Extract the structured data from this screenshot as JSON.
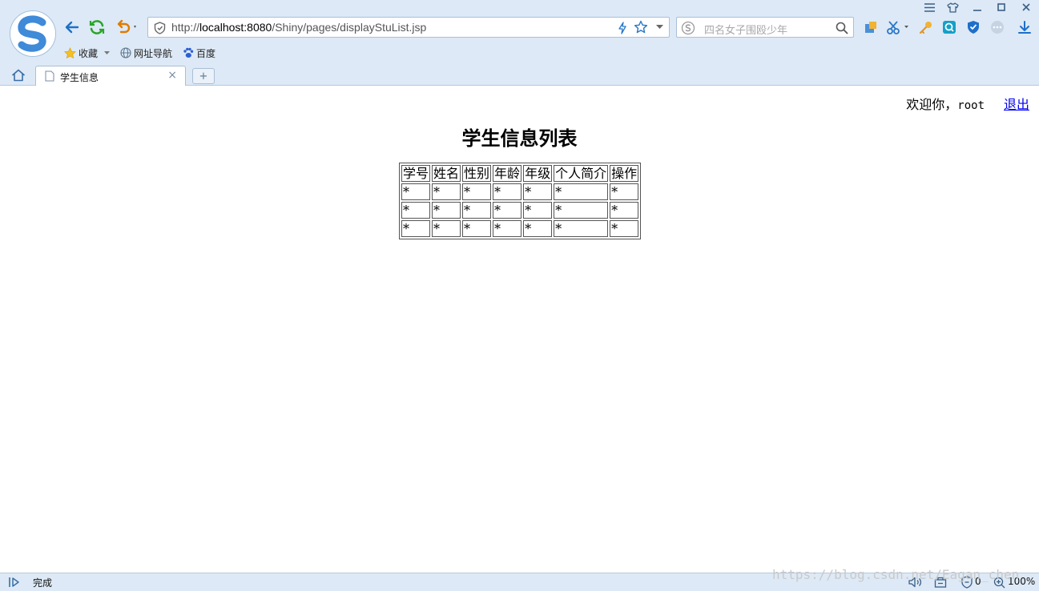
{
  "browser": {
    "url_prefix": "http://",
    "url_host": "localhost:8080",
    "url_path": "/Shiny/pages/displayStuList.jsp",
    "search_placeholder": "四名女子围殴少年",
    "bookmarks": [
      {
        "label": "收藏",
        "icon": "star-icon"
      },
      {
        "label": "网址导航",
        "icon": "globe-icon"
      },
      {
        "label": "百度",
        "icon": "baidu-paw-icon"
      }
    ],
    "tab_title": "学生信息",
    "status_text": "完成",
    "zoom": "100%",
    "blocked_count": "0",
    "watermark": "https://blog.csdn.net/Eagan_chen"
  },
  "page": {
    "welcome_prefix": "欢迎你，",
    "username": "root",
    "logout_label": "退出",
    "title": "学生信息列表",
    "table": {
      "headers": [
        "学号",
        "姓名",
        "性别",
        "年龄",
        "年级",
        "个人简介",
        "操作"
      ],
      "rows": [
        [
          "*",
          "*",
          "*",
          "*",
          "*",
          "*",
          "*"
        ],
        [
          "*",
          "*",
          "*",
          "*",
          "*",
          "*",
          "*"
        ],
        [
          "*",
          "*",
          "*",
          "*",
          "*",
          "*",
          "*"
        ]
      ]
    }
  },
  "colors": {
    "chrome_bg": "#dde9f6",
    "link": "#0000ee",
    "refresh_green": "#2aa52a",
    "undo_orange": "#e07b00",
    "nav_blue": "#1e6fc8"
  }
}
